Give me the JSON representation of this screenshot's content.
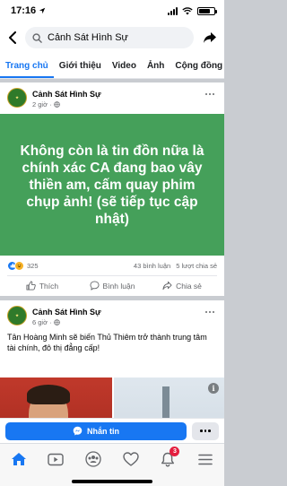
{
  "status_bar": {
    "time": "17:16"
  },
  "header": {
    "search_query": "Cảnh Sát Hình Sự"
  },
  "tabs": [
    {
      "label": "Trang chủ",
      "active": true
    },
    {
      "label": "Giới thiệu",
      "active": false
    },
    {
      "label": "Video",
      "active": false
    },
    {
      "label": "Ảnh",
      "active": false
    },
    {
      "label": "Cộng đồng",
      "active": false
    }
  ],
  "post1": {
    "page_name": "Cảnh Sát Hình Sự",
    "time": "2 giờ ·",
    "body": "Không còn là tin đồn nữa là chính xác CA đang bao vây thiền am, cấm quay phim chụp ảnh! (sẽ tiếp tục cập nhật)",
    "background_color": "#45a05a",
    "reaction_count": "325",
    "comments": "43 bình luận",
    "shares": "5 lượt chia sẻ",
    "actions": {
      "like": "Thích",
      "comment": "Bình luận",
      "share": "Chia sẻ"
    }
  },
  "post2": {
    "page_name": "Cảnh Sát Hình Sự",
    "time": "6 giờ ·",
    "body": "Tân Hoàng Minh sẽ biến Thủ Thiêm trở thành trung tâm tài chính, đô thị đẳng cấp!"
  },
  "message_bar": {
    "button_label": "Nhắn tin"
  },
  "bottom_nav": {
    "notifications_badge": "3"
  },
  "colors": {
    "accent": "#1877f2",
    "badge": "#e41e3f"
  }
}
